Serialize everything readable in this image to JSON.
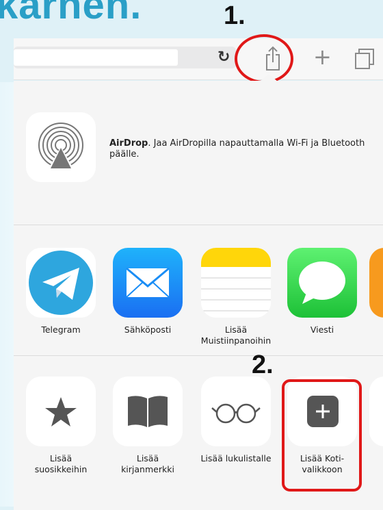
{
  "heading_fragment": "karnen.",
  "steps": {
    "one": "1.",
    "two": "2."
  },
  "toolbar": {
    "reload_icon": "reload-icon",
    "share_icon": "share-icon",
    "new_tab_icon": "plus-icon",
    "tabs_icon": "tabs-icon"
  },
  "airdrop": {
    "title": "AirDrop",
    "description": ". Jaa AirDropilla napauttamalla Wi-Fi ja Bluetooth päälle."
  },
  "apps": [
    {
      "label": "Telegram",
      "icon": "telegram-icon",
      "color": "#2ea6de"
    },
    {
      "label": "Sähköposti",
      "icon": "mail-icon",
      "color": "#1d8df5"
    },
    {
      "label": "Lisää Muistiinpanoihin",
      "icon": "notes-icon",
      "color": "#ffd60a"
    },
    {
      "label": "Viesti",
      "icon": "messages-icon",
      "color": "#3fd14e"
    }
  ],
  "actions": [
    {
      "label": "Lisää suosikkeihin",
      "icon": "star-icon"
    },
    {
      "label": "Lisää kirjanmerkki",
      "icon": "book-icon"
    },
    {
      "label": "Lisää lukulistalle",
      "icon": "glasses-icon"
    },
    {
      "label": "Lisää Koti-valikkoon",
      "icon": "add-home-icon"
    }
  ],
  "highlight_color": "#e01818"
}
